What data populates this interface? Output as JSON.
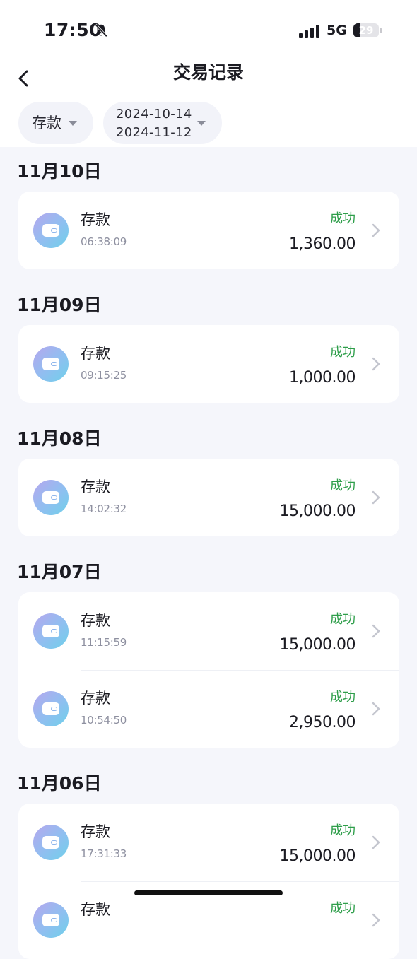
{
  "status_bar": {
    "time": "17:50",
    "network": "5G",
    "battery": "29",
    "battery_level": 0.29
  },
  "header": {
    "title": "交易记录"
  },
  "filters": {
    "type_label": "存款",
    "date_start": "2024-10-14",
    "date_end": "2024-11-12"
  },
  "groups": [
    {
      "date": "11月10日",
      "items": [
        {
          "name": "存款",
          "time": "06:38:09",
          "status": "成功",
          "amount": "1,360.00"
        }
      ]
    },
    {
      "date": "11月09日",
      "items": [
        {
          "name": "存款",
          "time": "09:15:25",
          "status": "成功",
          "amount": "1,000.00"
        }
      ]
    },
    {
      "date": "11月08日",
      "items": [
        {
          "name": "存款",
          "time": "14:02:32",
          "status": "成功",
          "amount": "15,000.00"
        }
      ]
    },
    {
      "date": "11月07日",
      "items": [
        {
          "name": "存款",
          "time": "11:15:59",
          "status": "成功",
          "amount": "15,000.00"
        },
        {
          "name": "存款",
          "time": "10:54:50",
          "status": "成功",
          "amount": "2,950.00"
        }
      ]
    },
    {
      "date": "11月06日",
      "items": [
        {
          "name": "存款",
          "time": "17:31:33",
          "status": "成功",
          "amount": "15,000.00"
        },
        {
          "name": "存款",
          "time": "",
          "status": "成功",
          "amount": ""
        }
      ]
    }
  ],
  "colors": {
    "success": "#2e9e4a",
    "page_bg": "#f5f6fb",
    "card_bg": "#ffffff",
    "icon_gradient_start": "#b6a7ee",
    "icon_gradient_end": "#6fd0ea"
  },
  "icons": {
    "back": "chevron-left-icon",
    "silent": "bell-slash-icon",
    "dropdown": "caret-down-icon",
    "row_arrow": "chevron-right-icon",
    "wallet": "wallet-icon"
  }
}
